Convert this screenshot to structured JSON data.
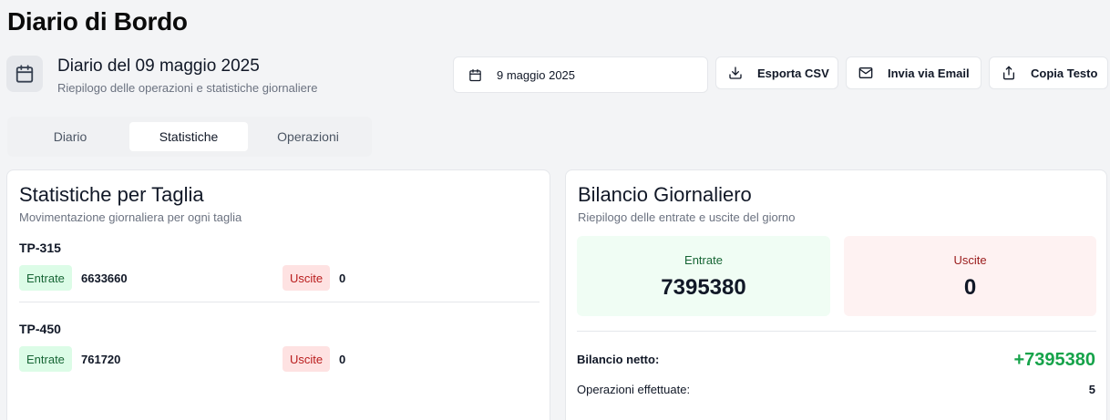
{
  "app": {
    "title": "Diario di Bordo"
  },
  "header": {
    "title": "Diario del 09 maggio 2025",
    "subtitle": "Riepilogo delle operazioni e statistiche giornaliere"
  },
  "toolbar": {
    "date_value": "9 maggio 2025",
    "export_csv_label": "Esporta CSV",
    "email_label": "Invia via Email",
    "copy_label": "Copia Testo"
  },
  "tabs": [
    {
      "label": "Diario",
      "active": false
    },
    {
      "label": "Statistiche",
      "active": true
    },
    {
      "label": "Operazioni",
      "active": false
    }
  ],
  "size_stats": {
    "title": "Statistiche per Taglia",
    "subtitle": "Movimentazione giornaliera per ogni taglia",
    "in_label": "Entrate",
    "out_label": "Uscite",
    "items": [
      {
        "name": "TP-315",
        "in": "6633660",
        "out": "0"
      },
      {
        "name": "TP-450",
        "in": "761720",
        "out": "0"
      }
    ]
  },
  "balance": {
    "title": "Bilancio Giornaliero",
    "subtitle": "Riepilogo delle entrate e uscite del giorno",
    "in_label": "Entrate",
    "in_value": "7395380",
    "out_label": "Uscite",
    "out_value": "0",
    "net_label": "Bilancio netto:",
    "net_value": "+7395380",
    "ops_label": "Operazioni effettuate:",
    "ops_value": "5"
  },
  "colors": {
    "accent_green": "#16a34a",
    "in_badge_bg": "#dcfce7",
    "out_badge_bg": "#fee2e2",
    "page_bg": "#f3f4f6"
  },
  "icons": {
    "header": "calendar-icon",
    "date_picker": "calendar-icon",
    "export": "download-icon",
    "email": "mail-icon",
    "copy": "share-icon"
  }
}
